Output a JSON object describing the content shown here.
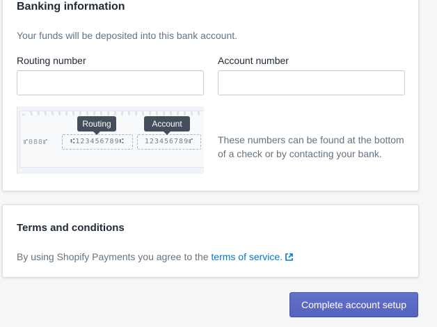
{
  "banking": {
    "title": "Banking information",
    "description": "Your funds will be deposited into this bank account.",
    "routing_label": "Routing number",
    "routing_value": "",
    "account_label": "Account number",
    "account_value": "",
    "check": {
      "routing_tip": "Routing",
      "account_tip": "Account",
      "check_number": "⑈088⑈",
      "routing_digits": "⑆123456789⑆",
      "account_digits": "123456789⑈"
    },
    "help_line1": "These numbers can be found at the bottom",
    "help_line2": "of a check or by contacting your bank."
  },
  "terms": {
    "title": "Terms and conditions",
    "text": "By using Shopify Payments you agree to the ",
    "link": "terms of service."
  },
  "actions": {
    "complete_label": "Complete account setup"
  },
  "colors": {
    "primary": "#5c6ac4",
    "link": "#007ace",
    "background": "#f4f6f8"
  },
  "icons": {
    "external_link": "external-link-icon"
  }
}
